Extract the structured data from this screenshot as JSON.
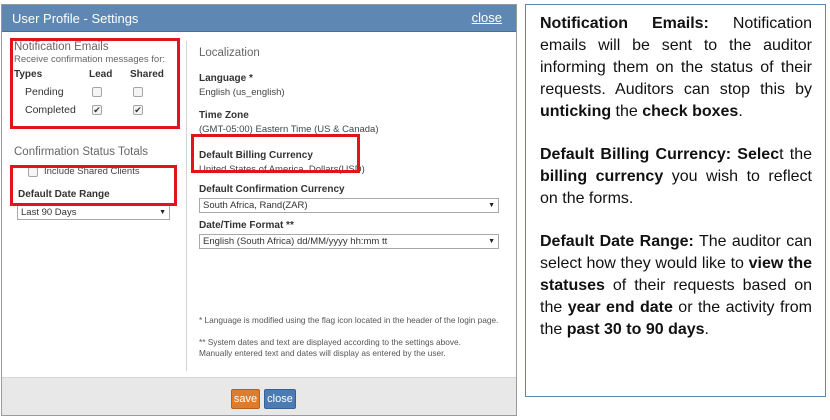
{
  "dialog": {
    "title": "User Profile - Settings",
    "close_link": "close",
    "notification_emails": {
      "heading": "Notification Emails",
      "subtext": "Receive confirmation messages for:",
      "columns": [
        "Types",
        "Lead",
        "Shared"
      ],
      "rows": [
        {
          "label": "Pending",
          "lead": false,
          "shared": false
        },
        {
          "label": "Completed",
          "lead": true,
          "shared": true
        }
      ]
    },
    "confirmation_status_totals": {
      "heading": "Confirmation Status Totals",
      "include_label": "Include Shared Clients",
      "include_checked": false
    },
    "default_date_range": {
      "label": "Default Date Range",
      "value": "Last 90 Days"
    },
    "localization": {
      "heading": "Localization",
      "language_label": "Language *",
      "language_value": "English (us_english)",
      "timezone_label": "Time Zone",
      "timezone_value": "(GMT-05:00) Eastern Time (US & Canada)",
      "billing_label": "Default Billing Currency",
      "billing_value": "United States of America, Dollars(USD)",
      "confirmation_currency_label": "Default Confirmation Currency",
      "confirmation_currency_value": "South Africa, Rand(ZAR)",
      "datetime_label": "Date/Time Format **",
      "datetime_value": "English (South Africa) dd/MM/yyyy hh:mm tt"
    },
    "notes": {
      "note1": "* Language is modified using the flag icon located in the header of the login page.",
      "note2_line1": "** System dates and text are displayed according to the settings above.",
      "note2_line2": "Manually entered text and dates will display as entered by the user."
    },
    "buttons": {
      "save": "save",
      "close": "close"
    },
    "colors": {
      "titlebar": "#5e88b3",
      "save_button": "#e07b2a",
      "close_button": "#4c7bb3",
      "highlight_box": "#e2131a"
    }
  },
  "description": {
    "p1": {
      "b1": "Notification Emails:",
      "t1": " Notification emails will be sent to the auditor informing them on the status of their requests. Auditors can stop this by ",
      "b2": "unticking",
      "t2": " the ",
      "b3": "check boxes",
      "t3": "."
    },
    "p2": {
      "b1": "Default Billing Currency: Selec",
      "t1": "t the ",
      "b2": "billing currency",
      "t2": " you wish to reflect on the forms."
    },
    "p3": {
      "b1": "Default Date Range:",
      "t1": " The auditor can select how they would like to ",
      "b2": "view the statuses",
      "t2": " of their requests based on the ",
      "b3": "year end date",
      "t3": " or the activity from the ",
      "b4": "past 30 to 90 days",
      "t4": "."
    }
  }
}
